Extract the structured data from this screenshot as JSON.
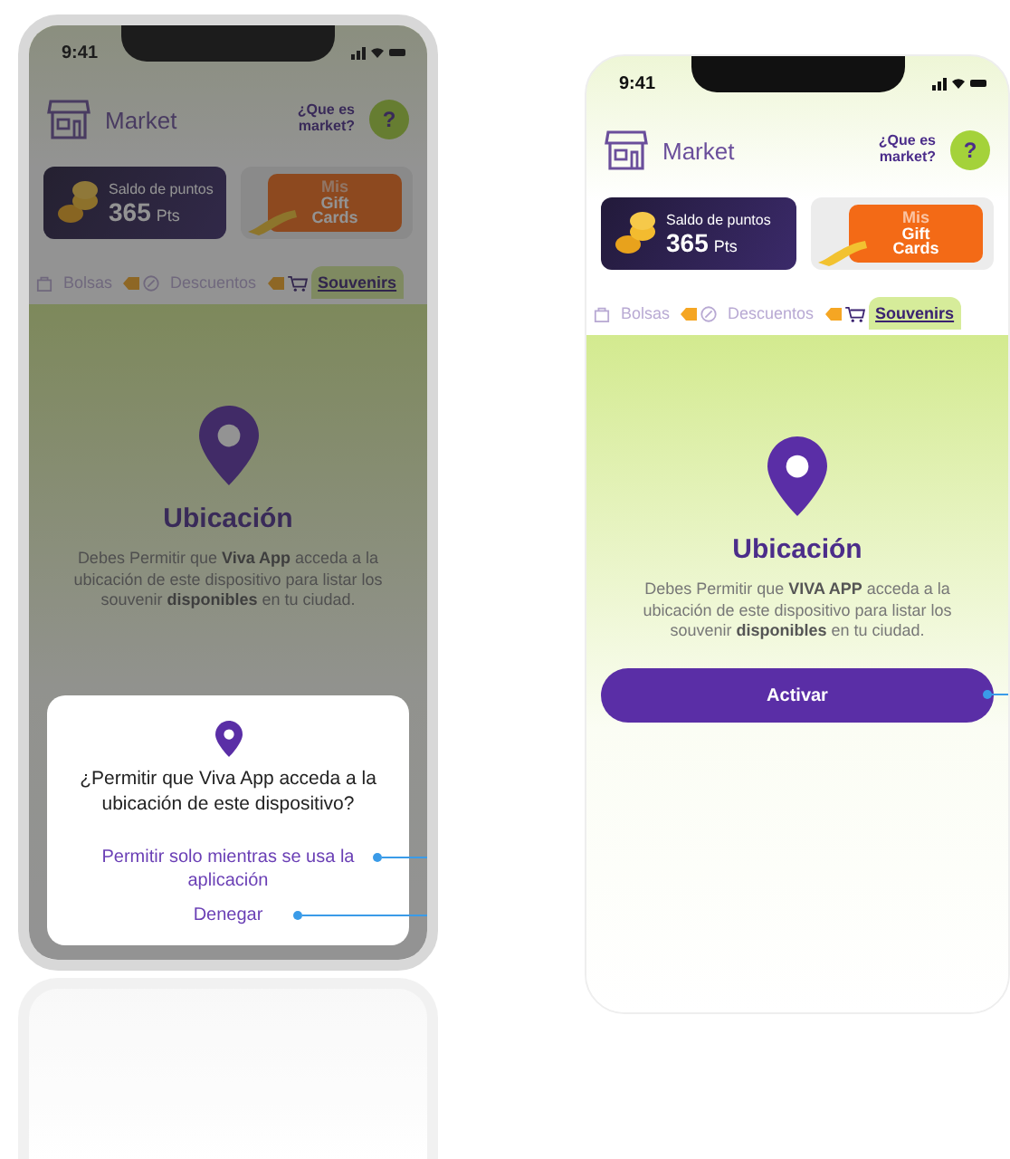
{
  "screens": [
    {
      "time": "9:41",
      "title": "Market",
      "help_label": "¿Que es market?",
      "help_button": "?",
      "points": {
        "label": "Saldo de puntos",
        "value": "365",
        "unit": "Pts"
      },
      "gift": [
        "Mis",
        "Gift",
        "Cards"
      ],
      "tabs": [
        {
          "label": "Bolsas",
          "selected": false,
          "tagged": true
        },
        {
          "label": "Descuentos",
          "selected": false,
          "tagged": true
        },
        {
          "label": "Souvenirs",
          "selected": true,
          "tagged": false
        }
      ],
      "location_title": "Ubicación",
      "description": "Debes Permitir que **Viva App** acceda a la ubicación de este dispositivo para listar los souvenir **disponibles** en tu ciudad.",
      "dimmed": true,
      "dialog": {
        "question": "¿Permitir que Viva App acceda a la ubicación de este dispositivo?",
        "options": [
          "Permitir solo mientras se usa la aplicación",
          "Denegar"
        ]
      }
    },
    {
      "time": "9:41",
      "title": "Market",
      "help_label": "¿Que es market?",
      "help_button": "?",
      "points": {
        "label": "Saldo de puntos",
        "value": "365",
        "unit": "Pts"
      },
      "gift": [
        "Mis",
        "Gift",
        "Cards"
      ],
      "tabs": [
        {
          "label": "Bolsas",
          "selected": false,
          "tagged": true
        },
        {
          "label": "Descuentos",
          "selected": false,
          "tagged": true
        },
        {
          "label": "Souvenirs",
          "selected": true,
          "tagged": false
        }
      ],
      "location_title": "Ubicación",
      "description": "Debes Permitir que **VIVA APP** acceda a la ubicación de este dispositivo para listar los souvenir **disponibles** en tu ciudad.",
      "dimmed": false,
      "button": "Activar"
    }
  ]
}
